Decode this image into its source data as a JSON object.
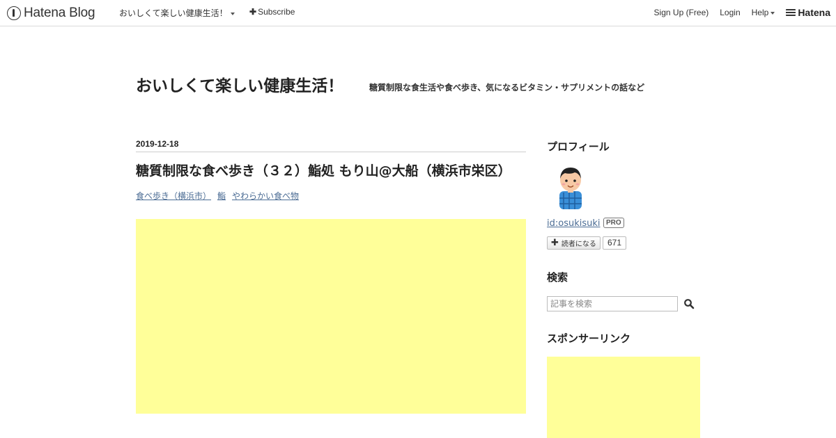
{
  "topbar": {
    "logo_text": "Hatena Blog",
    "blog_title": "おいしくて楽しい健康生活！",
    "subscribe_label": "Subscribe",
    "signup_label": "Sign Up (Free)",
    "login_label": "Login",
    "help_label": "Help",
    "brand_label": "Hatena"
  },
  "header": {
    "title": "おいしくて楽しい健康生活！",
    "description": "糖質制限な食生活や食べ歩き、気になるビタミン・サプリメントの話など"
  },
  "entry": {
    "date": "2019-12-18",
    "title": "糖質制限な食べ歩き（３２）鮨処 もり山@大船（横浜市栄区）",
    "categories": [
      "食べ歩き（横浜市）",
      "鮨",
      "やわらかい食べ物"
    ]
  },
  "sidebar": {
    "profile_heading": "プロフィール",
    "profile_id": "id:osukisuki",
    "pro_badge": "PRO",
    "reader_button_label": "読者になる",
    "reader_count": "671",
    "search_heading": "検索",
    "search_placeholder": "記事を検索",
    "sponsor_heading": "スポンサーリンク"
  },
  "colors": {
    "ad_placeholder": "#ffff99",
    "link": "#4b6c94"
  }
}
